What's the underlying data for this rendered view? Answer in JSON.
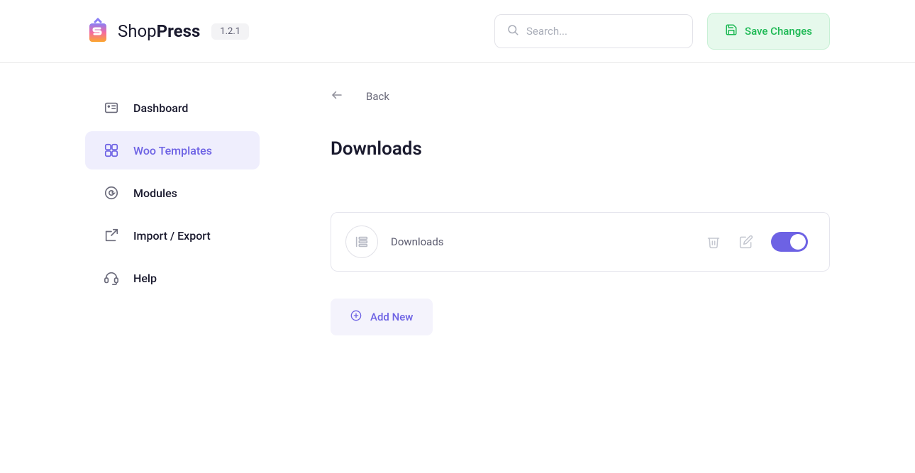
{
  "header": {
    "brand_first": "Shop",
    "brand_second": "Press",
    "version": "1.2.1",
    "search_placeholder": "Search...",
    "save_label": "Save Changes"
  },
  "sidebar": {
    "items": [
      {
        "label": "Dashboard"
      },
      {
        "label": "Woo Templates"
      },
      {
        "label": "Modules"
      },
      {
        "label": "Import / Export"
      },
      {
        "label": "Help"
      }
    ]
  },
  "main": {
    "back_label": "Back",
    "page_title": "Downloads",
    "template_item": {
      "name": "Downloads",
      "active": true
    },
    "add_new_label": "Add New"
  }
}
